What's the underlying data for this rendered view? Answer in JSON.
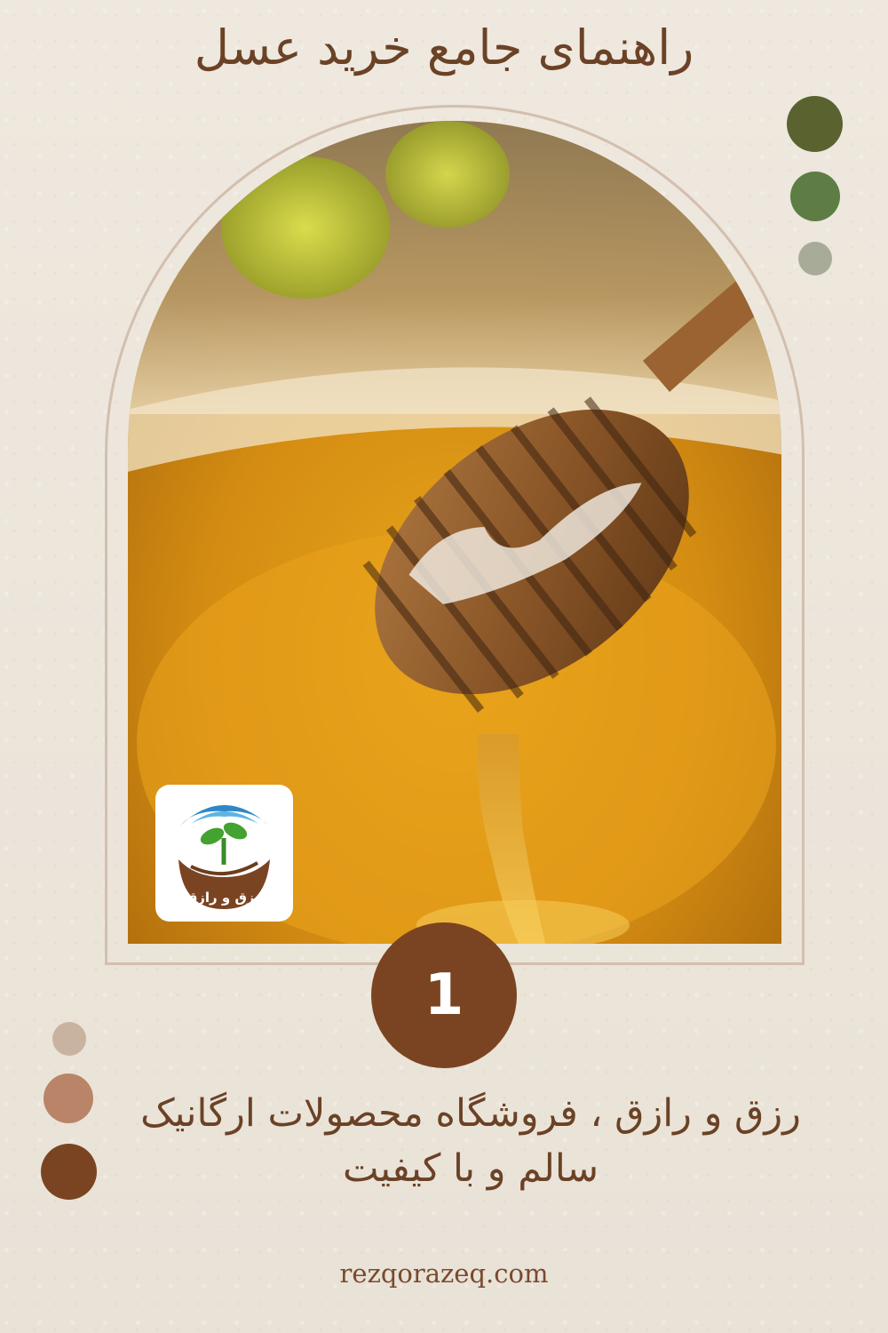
{
  "title": "راهنمای جامع خرید عسل",
  "palette_top": [
    "#5a6330",
    "#5e7d45",
    "#a9ab99"
  ],
  "palette_bottom": [
    "#c9b3a0",
    "#b98467",
    "#7a4422"
  ],
  "photo": {
    "subject": "honey-dipper-over-honey-jar"
  },
  "logo": {
    "text": "رزق و رازق"
  },
  "step_number": "1",
  "subtitle": {
    "line1": "رزق و رازق ، فروشگاه محصولات ارگانیک",
    "line2": "سالم و با کیفیت"
  },
  "website": "rezqorazeq.com"
}
